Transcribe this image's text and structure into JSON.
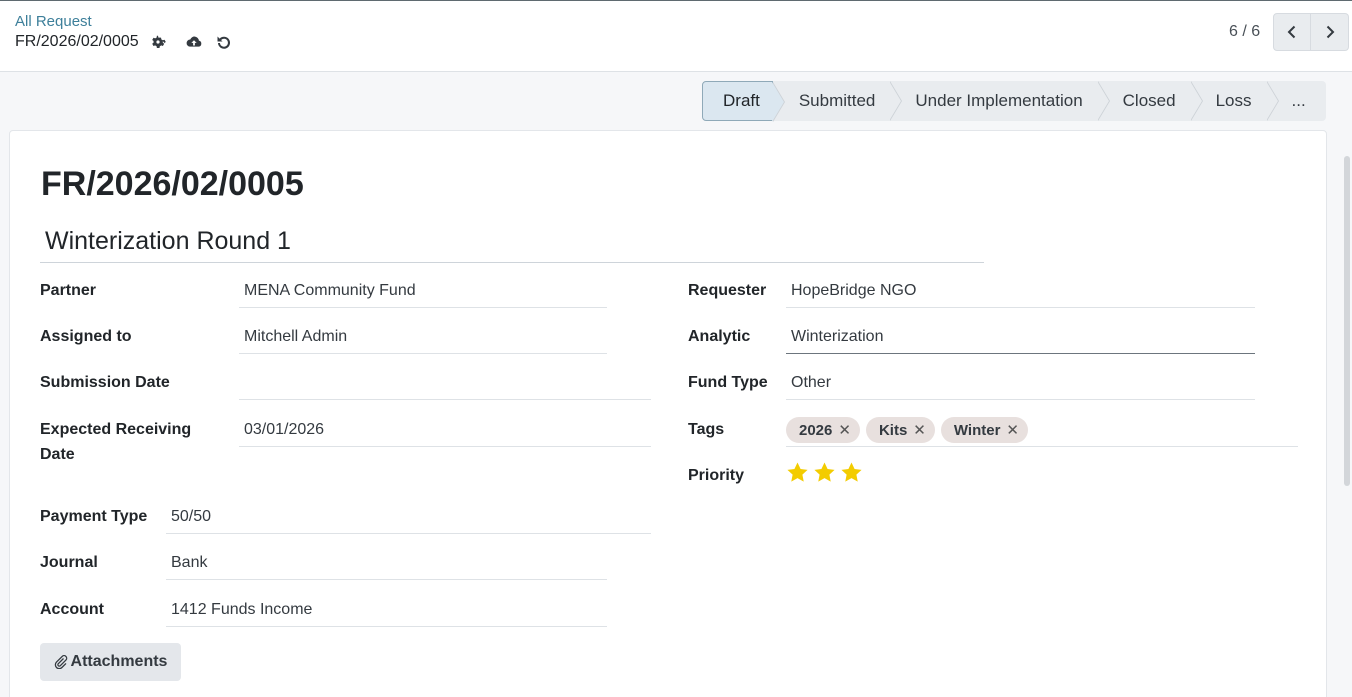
{
  "breadcrumb": {
    "parent": "All Request",
    "record": "FR/2026/02/0005"
  },
  "pager": {
    "text": "6 / 6"
  },
  "stages": [
    "Draft",
    "Submitted",
    "Under Implementation",
    "Closed",
    "Loss",
    "..."
  ],
  "record": {
    "number": "FR/2026/02/0005",
    "name": "Winterization Round 1"
  },
  "left_fields": {
    "partner": {
      "label": "Partner",
      "value": "MENA Community Fund"
    },
    "assigned_to": {
      "label": "Assigned to",
      "value": "Mitchell Admin"
    },
    "submission_date": {
      "label": "Submission Date",
      "value": ""
    },
    "expected_receiving_date": {
      "label": "Expected Receiving Date",
      "value": "03/01/2026"
    },
    "payment_type": {
      "label": "Payment Type",
      "value": "50/50"
    },
    "journal": {
      "label": "Journal",
      "value": "Bank"
    },
    "account": {
      "label": "Account",
      "value": "1412 Funds Income"
    }
  },
  "right_fields": {
    "requester": {
      "label": "Requester",
      "value": "HopeBridge NGO"
    },
    "analytic": {
      "label": "Analytic",
      "value": "Winterization"
    },
    "fund_type": {
      "label": "Fund Type",
      "value": "Other"
    },
    "tags": {
      "label": "Tags",
      "items": [
        "2026",
        "Kits",
        "Winter"
      ]
    },
    "priority": {
      "label": "Priority",
      "stars": 3,
      "max_stars": 3
    }
  },
  "buttons": {
    "attachments": "Attachments"
  },
  "colors": {
    "accent": "#3d7f9a",
    "star": "#f3cc00",
    "active_stage": "#dbe7f0"
  },
  "icons": [
    "gear-icon",
    "cloud-upload-icon",
    "undo-icon",
    "chevron-left-icon",
    "chevron-right-icon",
    "paperclip-icon",
    "star-icon",
    "close-icon"
  ]
}
